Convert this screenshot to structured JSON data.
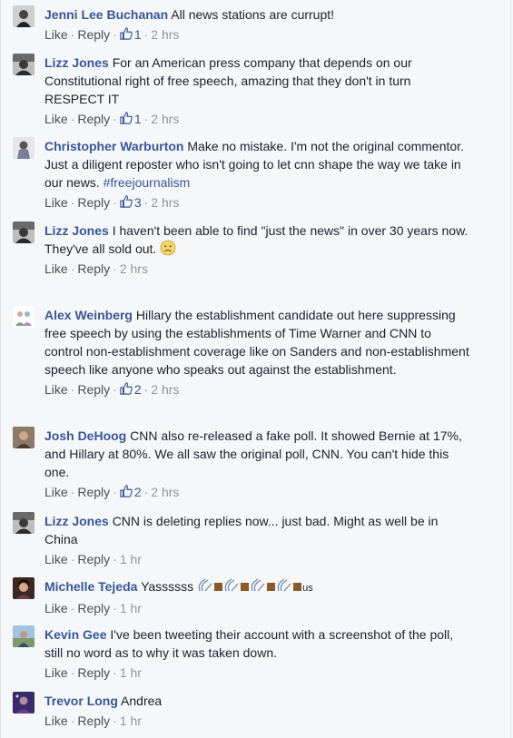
{
  "actions": {
    "like": "Like",
    "reply": "Reply",
    "sep": "·"
  },
  "comments": [
    {
      "author": "Jenni Lee Buchanan",
      "text": "All news stations are currupt!",
      "likes": "1",
      "time": "2 hrs"
    },
    {
      "author": "Lizz Jones",
      "text": "For an American press company that depends on our Constitutional right of free speech, amazing that they don't in turn RESPECT IT",
      "likes": "1",
      "time": "2 hrs"
    },
    {
      "author": "Christopher Warburton",
      "text": "Make no mistake. I'm not the original commentor. Just a diligent reposter who isn't going to let cnn shape the way we take in our news.",
      "hashtag": "#freejournalism",
      "likes": "3",
      "time": "2 hrs"
    },
    {
      "author": "Lizz Jones",
      "text": "I haven't been able to find \"just the news\" in over 30 years now.",
      "text2": "They've all sold out.",
      "time": "2 hrs"
    },
    {
      "author": "Alex Weinberg",
      "text": "Hillary the establishment candidate out here suppressing free speech by using the establishments of Time Warner and CNN to control non-establishment coverage like on Sanders and non-establishment speech like anyone who speaks out against the establishment.",
      "likes": "2",
      "time": "2 hrs"
    },
    {
      "author": "Josh DeHoog",
      "text": "CNN also re-released a fake poll. It showed Bernie at 17%, and Hillary at 80%. We all saw the original poll, CNN. You can't hide this one.",
      "likes": "2",
      "time": "2 hrs"
    },
    {
      "author": "Lizz Jones",
      "text": "CNN is deleting replies now... just bad. Might as well be in China",
      "time": "1 hr"
    },
    {
      "author": "Michelle Tejeda",
      "text": "Yassssss",
      "suffix": "us",
      "time": "1 hr"
    },
    {
      "author": "Kevin Gee",
      "text": "I've been tweeting their account with a screenshot of the poll, still no word as to why it was taken down.",
      "time": "1 hr"
    },
    {
      "author": "Trevor Long",
      "text": "Andrea",
      "time": "1 hr"
    }
  ]
}
